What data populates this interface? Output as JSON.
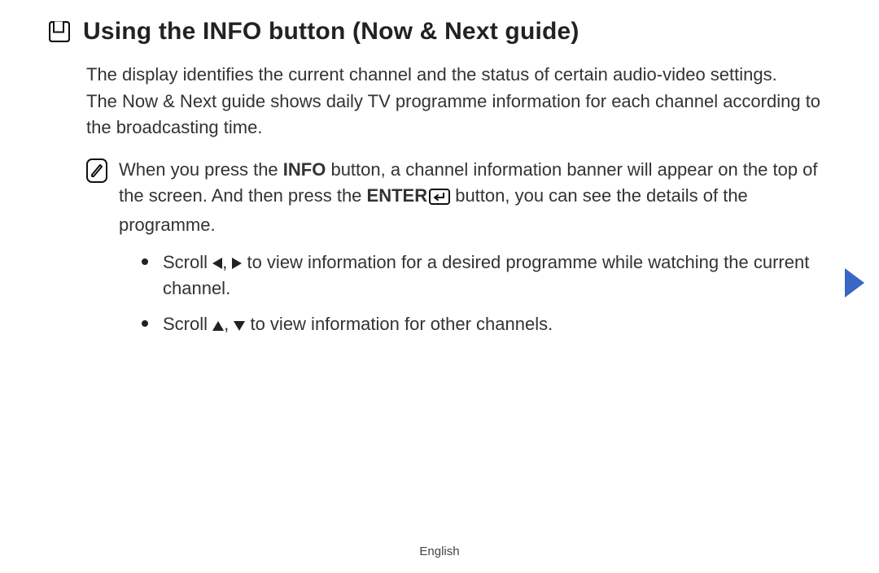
{
  "heading": "Using the INFO button (Now & Next guide)",
  "para1": "The display identifies the current channel and the status of certain audio-video settings.",
  "para2": "The Now & Next guide shows daily TV programme information for each channel according to the broadcasting time.",
  "note": {
    "pre": "When you press the ",
    "infoWord": "INFO",
    "mid": " button, a channel information banner will appear on the top of the screen. And then press the ",
    "enterWord": "ENTER",
    "post": " button, you can see the details of the programme."
  },
  "bullets": {
    "b1_pre": "Scroll ",
    "b1_post": " to view information for a desired programme while watching the current channel.",
    "b2_pre": "Scroll ",
    "b2_post": " to view information for other channels."
  },
  "footer": "English",
  "sep": ", "
}
